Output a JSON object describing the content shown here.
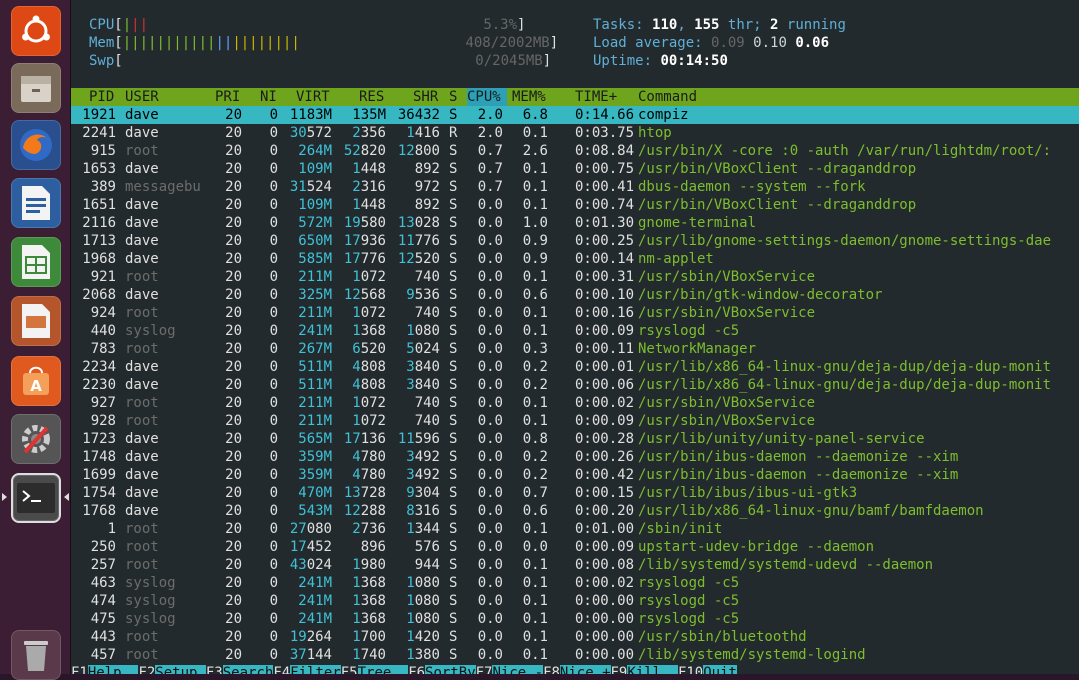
{
  "launcher": {
    "items": [
      "ubuntu-dash",
      "files",
      "firefox",
      "writer",
      "calc",
      "impress",
      "software-center",
      "system-settings",
      "terminal",
      "trash"
    ]
  },
  "header": {
    "cpu_label": "CPU",
    "cpu_value": "5.3%",
    "mem_label": "Mem",
    "mem_value": "408/2002MB",
    "swp_label": "Swp",
    "swp_value": "0/2045MB",
    "tasks_label": "Tasks: ",
    "tasks_count": "110",
    "tasks_sep": ", ",
    "threads_count": "155",
    "threads_label": " thr; ",
    "running_count": "2",
    "running_label": " running",
    "load_label": "Load average: ",
    "load1": "0.09",
    "load5": "0.10",
    "load15": "0.06",
    "uptime_label": "Uptime: ",
    "uptime_value": "00:14:50"
  },
  "columns": [
    "PID",
    "USER",
    "PRI",
    "NI",
    "VIRT",
    "RES",
    "SHR",
    "S",
    "CPU%",
    "MEM%",
    "TIME+",
    "Command"
  ],
  "processes": [
    {
      "pid": "1921",
      "user": "dave",
      "pri": "20",
      "ni": "0",
      "virt": "1183M",
      "res": "135M",
      "shr": "36432",
      "s": "S",
      "cpu": "2.0",
      "mem": "6.8",
      "time": "0:14.66",
      "cmd": "compiz"
    },
    {
      "pid": "2241",
      "user": "dave",
      "pri": "20",
      "ni": "0",
      "virt": "30572",
      "res": "2356",
      "shr": "1416",
      "s": "R",
      "cpu": "2.0",
      "mem": "0.1",
      "time": "0:03.75",
      "cmd": "htop"
    },
    {
      "pid": "915",
      "user": "root",
      "pri": "20",
      "ni": "0",
      "virt": "264M",
      "res": "52820",
      "shr": "12800",
      "s": "S",
      "cpu": "0.7",
      "mem": "2.6",
      "time": "0:08.84",
      "cmd": "/usr/bin/X -core :0 -auth /var/run/lightdm/root/:"
    },
    {
      "pid": "1653",
      "user": "dave",
      "pri": "20",
      "ni": "0",
      "virt": "109M",
      "res": "1448",
      "shr": "892",
      "s": "S",
      "cpu": "0.7",
      "mem": "0.1",
      "time": "0:00.75",
      "cmd": "/usr/bin/VBoxClient --draganddrop"
    },
    {
      "pid": "389",
      "user": "messagebu",
      "pri": "20",
      "ni": "0",
      "virt": "31524",
      "res": "2316",
      "shr": "972",
      "s": "S",
      "cpu": "0.7",
      "mem": "0.1",
      "time": "0:00.41",
      "cmd": "dbus-daemon --system --fork"
    },
    {
      "pid": "1651",
      "user": "dave",
      "pri": "20",
      "ni": "0",
      "virt": "109M",
      "res": "1448",
      "shr": "892",
      "s": "S",
      "cpu": "0.0",
      "mem": "0.1",
      "time": "0:00.74",
      "cmd": "/usr/bin/VBoxClient --draganddrop"
    },
    {
      "pid": "2116",
      "user": "dave",
      "pri": "20",
      "ni": "0",
      "virt": "572M",
      "res": "19580",
      "shr": "13028",
      "s": "S",
      "cpu": "0.0",
      "mem": "1.0",
      "time": "0:01.30",
      "cmd": "gnome-terminal"
    },
    {
      "pid": "1713",
      "user": "dave",
      "pri": "20",
      "ni": "0",
      "virt": "650M",
      "res": "17936",
      "shr": "11776",
      "s": "S",
      "cpu": "0.0",
      "mem": "0.9",
      "time": "0:00.25",
      "cmd": "/usr/lib/gnome-settings-daemon/gnome-settings-dae"
    },
    {
      "pid": "1968",
      "user": "dave",
      "pri": "20",
      "ni": "0",
      "virt": "585M",
      "res": "17776",
      "shr": "12520",
      "s": "S",
      "cpu": "0.0",
      "mem": "0.9",
      "time": "0:00.14",
      "cmd": "nm-applet"
    },
    {
      "pid": "921",
      "user": "root",
      "pri": "20",
      "ni": "0",
      "virt": "211M",
      "res": "1072",
      "shr": "740",
      "s": "S",
      "cpu": "0.0",
      "mem": "0.1",
      "time": "0:00.31",
      "cmd": "/usr/sbin/VBoxService"
    },
    {
      "pid": "2068",
      "user": "dave",
      "pri": "20",
      "ni": "0",
      "virt": "325M",
      "res": "12568",
      "shr": "9536",
      "s": "S",
      "cpu": "0.0",
      "mem": "0.6",
      "time": "0:00.10",
      "cmd": "/usr/bin/gtk-window-decorator"
    },
    {
      "pid": "924",
      "user": "root",
      "pri": "20",
      "ni": "0",
      "virt": "211M",
      "res": "1072",
      "shr": "740",
      "s": "S",
      "cpu": "0.0",
      "mem": "0.1",
      "time": "0:00.16",
      "cmd": "/usr/sbin/VBoxService"
    },
    {
      "pid": "440",
      "user": "syslog",
      "pri": "20",
      "ni": "0",
      "virt": "241M",
      "res": "1368",
      "shr": "1080",
      "s": "S",
      "cpu": "0.0",
      "mem": "0.1",
      "time": "0:00.09",
      "cmd": "rsyslogd -c5"
    },
    {
      "pid": "783",
      "user": "root",
      "pri": "20",
      "ni": "0",
      "virt": "267M",
      "res": "6520",
      "shr": "5024",
      "s": "S",
      "cpu": "0.0",
      "mem": "0.3",
      "time": "0:00.11",
      "cmd": "NetworkManager"
    },
    {
      "pid": "2234",
      "user": "dave",
      "pri": "20",
      "ni": "0",
      "virt": "511M",
      "res": "4808",
      "shr": "3840",
      "s": "S",
      "cpu": "0.0",
      "mem": "0.2",
      "time": "0:00.01",
      "cmd": "/usr/lib/x86_64-linux-gnu/deja-dup/deja-dup-monit"
    },
    {
      "pid": "2230",
      "user": "dave",
      "pri": "20",
      "ni": "0",
      "virt": "511M",
      "res": "4808",
      "shr": "3840",
      "s": "S",
      "cpu": "0.0",
      "mem": "0.2",
      "time": "0:00.06",
      "cmd": "/usr/lib/x86_64-linux-gnu/deja-dup/deja-dup-monit"
    },
    {
      "pid": "927",
      "user": "root",
      "pri": "20",
      "ni": "0",
      "virt": "211M",
      "res": "1072",
      "shr": "740",
      "s": "S",
      "cpu": "0.0",
      "mem": "0.1",
      "time": "0:00.02",
      "cmd": "/usr/sbin/VBoxService"
    },
    {
      "pid": "928",
      "user": "root",
      "pri": "20",
      "ni": "0",
      "virt": "211M",
      "res": "1072",
      "shr": "740",
      "s": "S",
      "cpu": "0.0",
      "mem": "0.1",
      "time": "0:00.09",
      "cmd": "/usr/sbin/VBoxService"
    },
    {
      "pid": "1723",
      "user": "dave",
      "pri": "20",
      "ni": "0",
      "virt": "565M",
      "res": "17136",
      "shr": "11596",
      "s": "S",
      "cpu": "0.0",
      "mem": "0.8",
      "time": "0:00.28",
      "cmd": "/usr/lib/unity/unity-panel-service"
    },
    {
      "pid": "1748",
      "user": "dave",
      "pri": "20",
      "ni": "0",
      "virt": "359M",
      "res": "4780",
      "shr": "3492",
      "s": "S",
      "cpu": "0.0",
      "mem": "0.2",
      "time": "0:00.26",
      "cmd": "/usr/bin/ibus-daemon --daemonize --xim"
    },
    {
      "pid": "1699",
      "user": "dave",
      "pri": "20",
      "ni": "0",
      "virt": "359M",
      "res": "4780",
      "shr": "3492",
      "s": "S",
      "cpu": "0.0",
      "mem": "0.2",
      "time": "0:00.42",
      "cmd": "/usr/bin/ibus-daemon --daemonize --xim"
    },
    {
      "pid": "1754",
      "user": "dave",
      "pri": "20",
      "ni": "0",
      "virt": "470M",
      "res": "13728",
      "shr": "9304",
      "s": "S",
      "cpu": "0.0",
      "mem": "0.7",
      "time": "0:00.15",
      "cmd": "/usr/lib/ibus/ibus-ui-gtk3"
    },
    {
      "pid": "1768",
      "user": "dave",
      "pri": "20",
      "ni": "0",
      "virt": "543M",
      "res": "12288",
      "shr": "8316",
      "s": "S",
      "cpu": "0.0",
      "mem": "0.6",
      "time": "0:00.20",
      "cmd": "/usr/lib/x86_64-linux-gnu/bamf/bamfdaemon"
    },
    {
      "pid": "1",
      "user": "root",
      "pri": "20",
      "ni": "0",
      "virt": "27080",
      "res": "2736",
      "shr": "1344",
      "s": "S",
      "cpu": "0.0",
      "mem": "0.1",
      "time": "0:01.00",
      "cmd": "/sbin/init"
    },
    {
      "pid": "250",
      "user": "root",
      "pri": "20",
      "ni": "0",
      "virt": "17452",
      "res": "896",
      "shr": "576",
      "s": "S",
      "cpu": "0.0",
      "mem": "0.0",
      "time": "0:00.09",
      "cmd": "upstart-udev-bridge --daemon"
    },
    {
      "pid": "257",
      "user": "root",
      "pri": "20",
      "ni": "0",
      "virt": "43024",
      "res": "1980",
      "shr": "944",
      "s": "S",
      "cpu": "0.0",
      "mem": "0.1",
      "time": "0:00.08",
      "cmd": "/lib/systemd/systemd-udevd --daemon"
    },
    {
      "pid": "463",
      "user": "syslog",
      "pri": "20",
      "ni": "0",
      "virt": "241M",
      "res": "1368",
      "shr": "1080",
      "s": "S",
      "cpu": "0.0",
      "mem": "0.1",
      "time": "0:00.02",
      "cmd": "rsyslogd -c5"
    },
    {
      "pid": "474",
      "user": "syslog",
      "pri": "20",
      "ni": "0",
      "virt": "241M",
      "res": "1368",
      "shr": "1080",
      "s": "S",
      "cpu": "0.0",
      "mem": "0.1",
      "time": "0:00.00",
      "cmd": "rsyslogd -c5"
    },
    {
      "pid": "475",
      "user": "syslog",
      "pri": "20",
      "ni": "0",
      "virt": "241M",
      "res": "1368",
      "shr": "1080",
      "s": "S",
      "cpu": "0.0",
      "mem": "0.1",
      "time": "0:00.00",
      "cmd": "rsyslogd -c5"
    },
    {
      "pid": "443",
      "user": "root",
      "pri": "20",
      "ni": "0",
      "virt": "19264",
      "res": "1700",
      "shr": "1420",
      "s": "S",
      "cpu": "0.0",
      "mem": "0.1",
      "time": "0:00.00",
      "cmd": "/usr/sbin/bluetoothd"
    },
    {
      "pid": "457",
      "user": "root",
      "pri": "20",
      "ni": "0",
      "virt": "37144",
      "res": "1740",
      "shr": "1380",
      "s": "S",
      "cpu": "0.0",
      "mem": "0.1",
      "time": "0:00.00",
      "cmd": "/lib/systemd/systemd-logind"
    }
  ],
  "footer": [
    {
      "key": "F1",
      "label": "Help  "
    },
    {
      "key": "F2",
      "label": "Setup "
    },
    {
      "key": "F3",
      "label": "Search"
    },
    {
      "key": "F4",
      "label": "Filter"
    },
    {
      "key": "F5",
      "label": "Tree  "
    },
    {
      "key": "F6",
      "label": "SortBy"
    },
    {
      "key": "F7",
      "label": "Nice -"
    },
    {
      "key": "F8",
      "label": "Nice +"
    },
    {
      "key": "F9",
      "label": "Kill  "
    },
    {
      "key": "F10",
      "label": "Quit"
    }
  ],
  "colors": {
    "header_bar": "#6fa51d",
    "selected_row": "#36b7c2",
    "launcher_bg": "#3b1e33"
  }
}
